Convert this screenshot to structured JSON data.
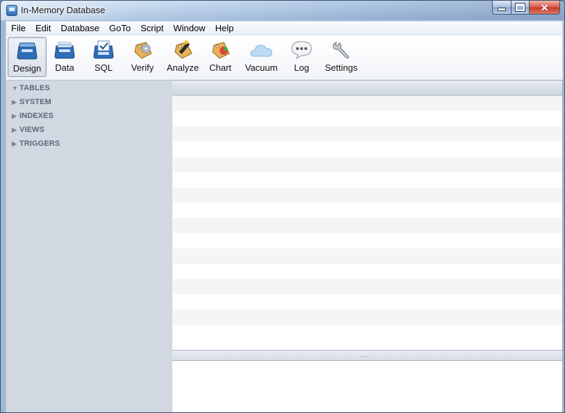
{
  "window": {
    "title": "In-Memory Database",
    "controls": {
      "minimize_icon": "minimize-icon",
      "maximize_icon": "maximize-icon",
      "close_icon": "close-icon",
      "close_glyph": "✕"
    }
  },
  "menu": [
    "File",
    "Edit",
    "Database",
    "GoTo",
    "Script",
    "Window",
    "Help"
  ],
  "toolbar": [
    {
      "label": "Design",
      "icon": "design-icon",
      "active": true
    },
    {
      "label": "Data",
      "icon": "data-icon"
    },
    {
      "label": "SQL",
      "icon": "sql-icon"
    },
    {
      "label": "Verify",
      "icon": "verify-icon"
    },
    {
      "label": "Analyze",
      "icon": "analyze-icon"
    },
    {
      "label": "Chart",
      "icon": "chart-icon"
    },
    {
      "label": "Vacuum",
      "icon": "vacuum-icon"
    },
    {
      "label": "Log",
      "icon": "log-icon"
    },
    {
      "label": "Settings",
      "icon": "settings-icon"
    }
  ],
  "sidebar": {
    "items": [
      {
        "label": "TABLES",
        "arrow": "▼",
        "expanded": true
      },
      {
        "label": "SYSTEM",
        "arrow": "▶",
        "expanded": false
      },
      {
        "label": "INDEXES",
        "arrow": "▶",
        "expanded": false
      },
      {
        "label": "VIEWS",
        "arrow": "▶",
        "expanded": false
      },
      {
        "label": "TRIGGERS",
        "arrow": "▶",
        "expanded": false
      }
    ]
  },
  "content": {
    "splitter_grip": "....."
  },
  "colors": {
    "sidebar_bg": "#d2d8e1",
    "stripe": "#f4f5f7",
    "accent_blue": "#2f6db8"
  }
}
